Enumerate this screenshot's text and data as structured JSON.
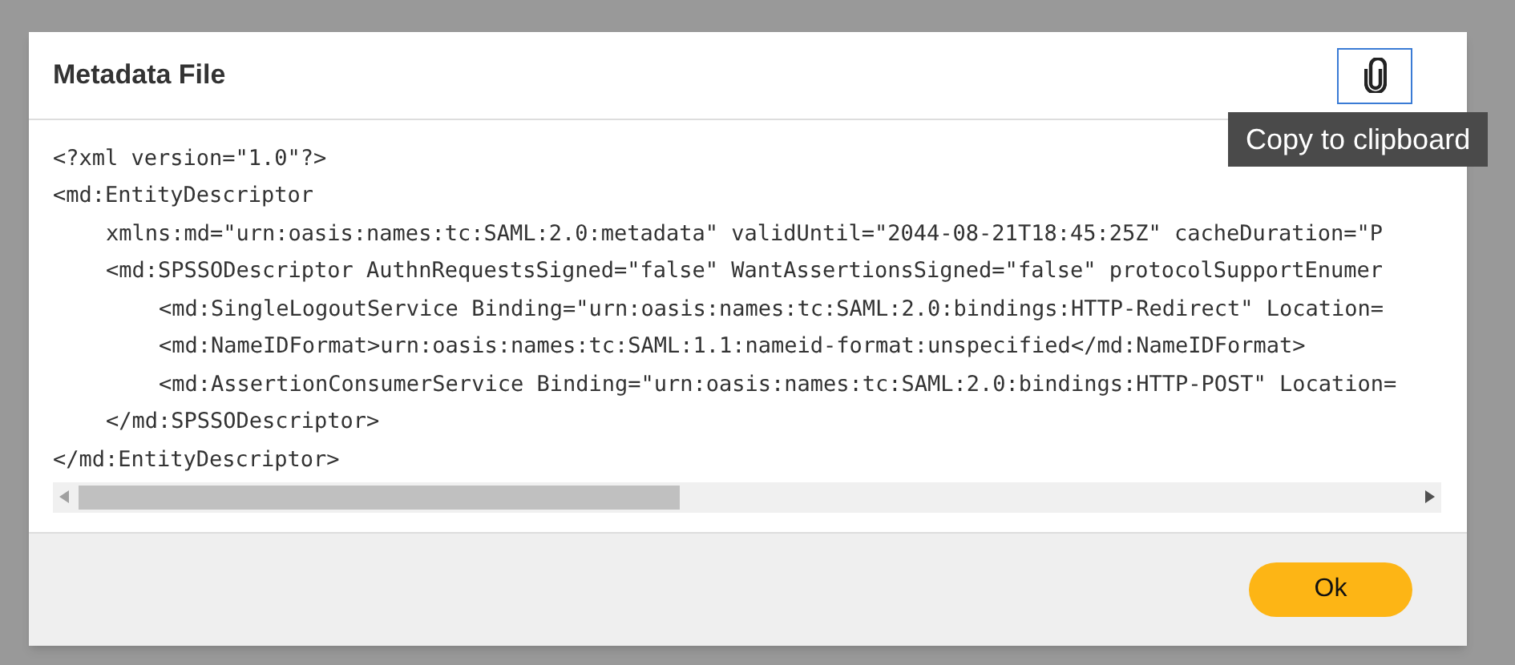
{
  "dialog": {
    "title": "Metadata File",
    "copy_tooltip": "Copy to clipboard",
    "code_lines": [
      {
        "text": "<?xml version=\"1.0\"?>"
      },
      {
        "text": "<md:EntityDescriptor",
        "children": [
          {
            "text": "xmlns:md=\"urn:oasis:names:tc:SAML:2.0:metadata\" validUntil=\"2044-08-21T18:45:25Z\" cacheDuration=\"P"
          },
          {
            "text": "<md:SPSSODescriptor AuthnRequestsSigned=\"false\" WantAssertionsSigned=\"false\" protocolSupportEnumer",
            "children": [
              {
                "text": "<md:SingleLogoutService Binding=\"urn:oasis:names:tc:SAML:2.0:bindings:HTTP-Redirect\" Location="
              },
              {
                "text": "<md:NameIDFormat>urn:oasis:names:tc:SAML:1.1:nameid-format:unspecified</md:NameIDFormat>"
              },
              {
                "text": "<md:AssertionConsumerService Binding=\"urn:oasis:names:tc:SAML:2.0:bindings:HTTP-POST\" Location="
              }
            ]
          },
          {
            "text": "</md:SPSSODescriptor>"
          }
        ]
      },
      {
        "text": "</md:EntityDescriptor>"
      }
    ],
    "buttons": [
      "Ok"
    ]
  }
}
